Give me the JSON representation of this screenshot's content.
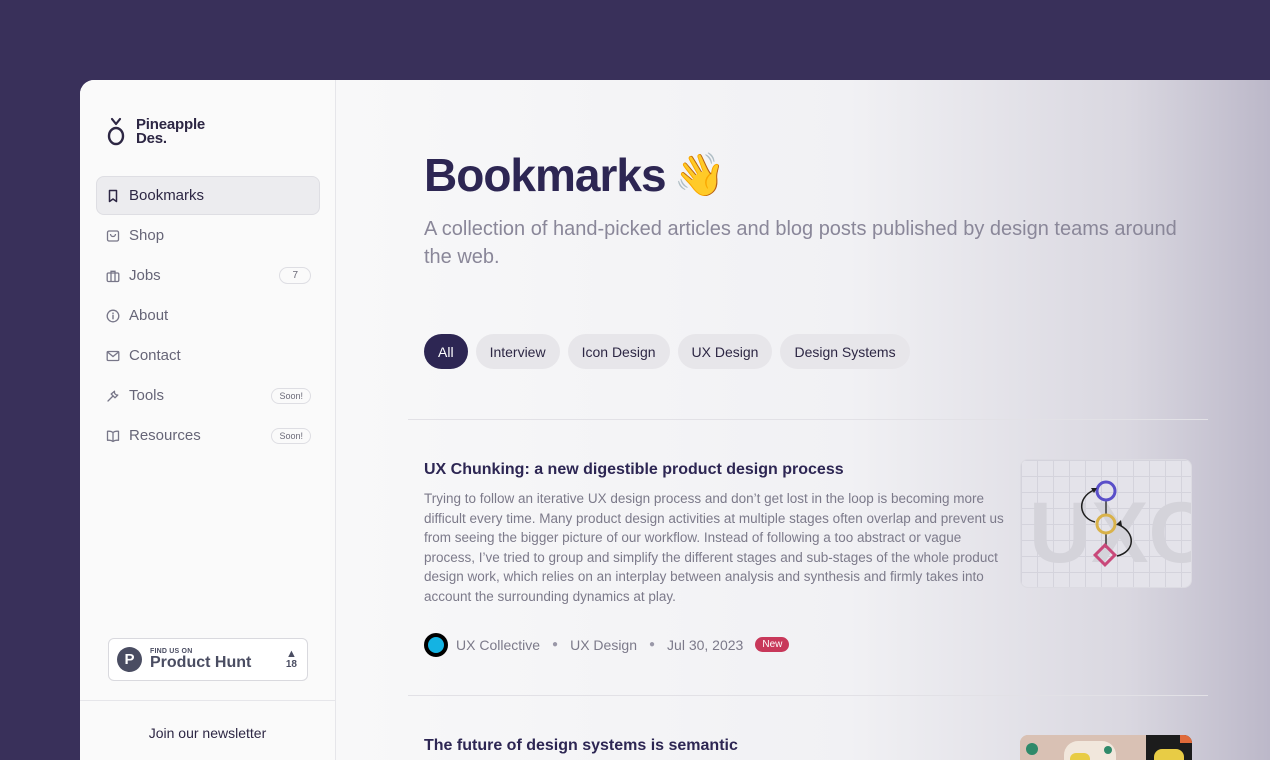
{
  "brand": {
    "line1": "Pineapple",
    "line2": "Des."
  },
  "sidebar": {
    "items": [
      {
        "label": "Bookmarks",
        "icon": "bookmark-icon",
        "active": true
      },
      {
        "label": "Shop",
        "icon": "shop-icon"
      },
      {
        "label": "Jobs",
        "icon": "briefcase-icon",
        "count": "7"
      },
      {
        "label": "About",
        "icon": "info-icon"
      },
      {
        "label": "Contact",
        "icon": "mail-icon"
      },
      {
        "label": "Tools",
        "icon": "wrench-icon",
        "badge": "Soon!"
      },
      {
        "label": "Resources",
        "icon": "book-icon",
        "badge": "Soon!"
      }
    ],
    "product_hunt": {
      "small": "FIND US ON",
      "big": "Product Hunt",
      "votes": "18",
      "logo": "P"
    },
    "newsletter": "Join our newsletter"
  },
  "main": {
    "title": "Bookmarks",
    "emoji": "👋",
    "subtitle": "A collection of hand-picked articles and blog posts published by design teams around the web.",
    "filters": [
      "All",
      "Interview",
      "Icon Design",
      "UX Design",
      "Design Systems"
    ],
    "active_filter": "All",
    "articles": [
      {
        "title": "UX Chunking: a new digestible product design process",
        "body": "Trying to follow an iterative UX design process and don’t get lost in the loop is becoming more difficult every time. Many product design activities at multiple stages often overlap and prevent us from seeing the bigger picture of our workflow. Instead of following a too abstract or vague process, I’ve tried to group and simplify the different stages and sub-stages of the whole product design work, which relies on an interplay between analysis and synthesis and firmly takes into account the surrounding dynamics at play.",
        "source": "UX Collective",
        "category": "UX Design",
        "date": "Jul 30, 2023",
        "badge": "New",
        "thumb_text": "UXC"
      },
      {
        "title": "The future of design systems is semantic"
      }
    ]
  },
  "colors": {
    "background": "#39305a",
    "accent": "#2d2653",
    "badge": "#c8385a"
  }
}
